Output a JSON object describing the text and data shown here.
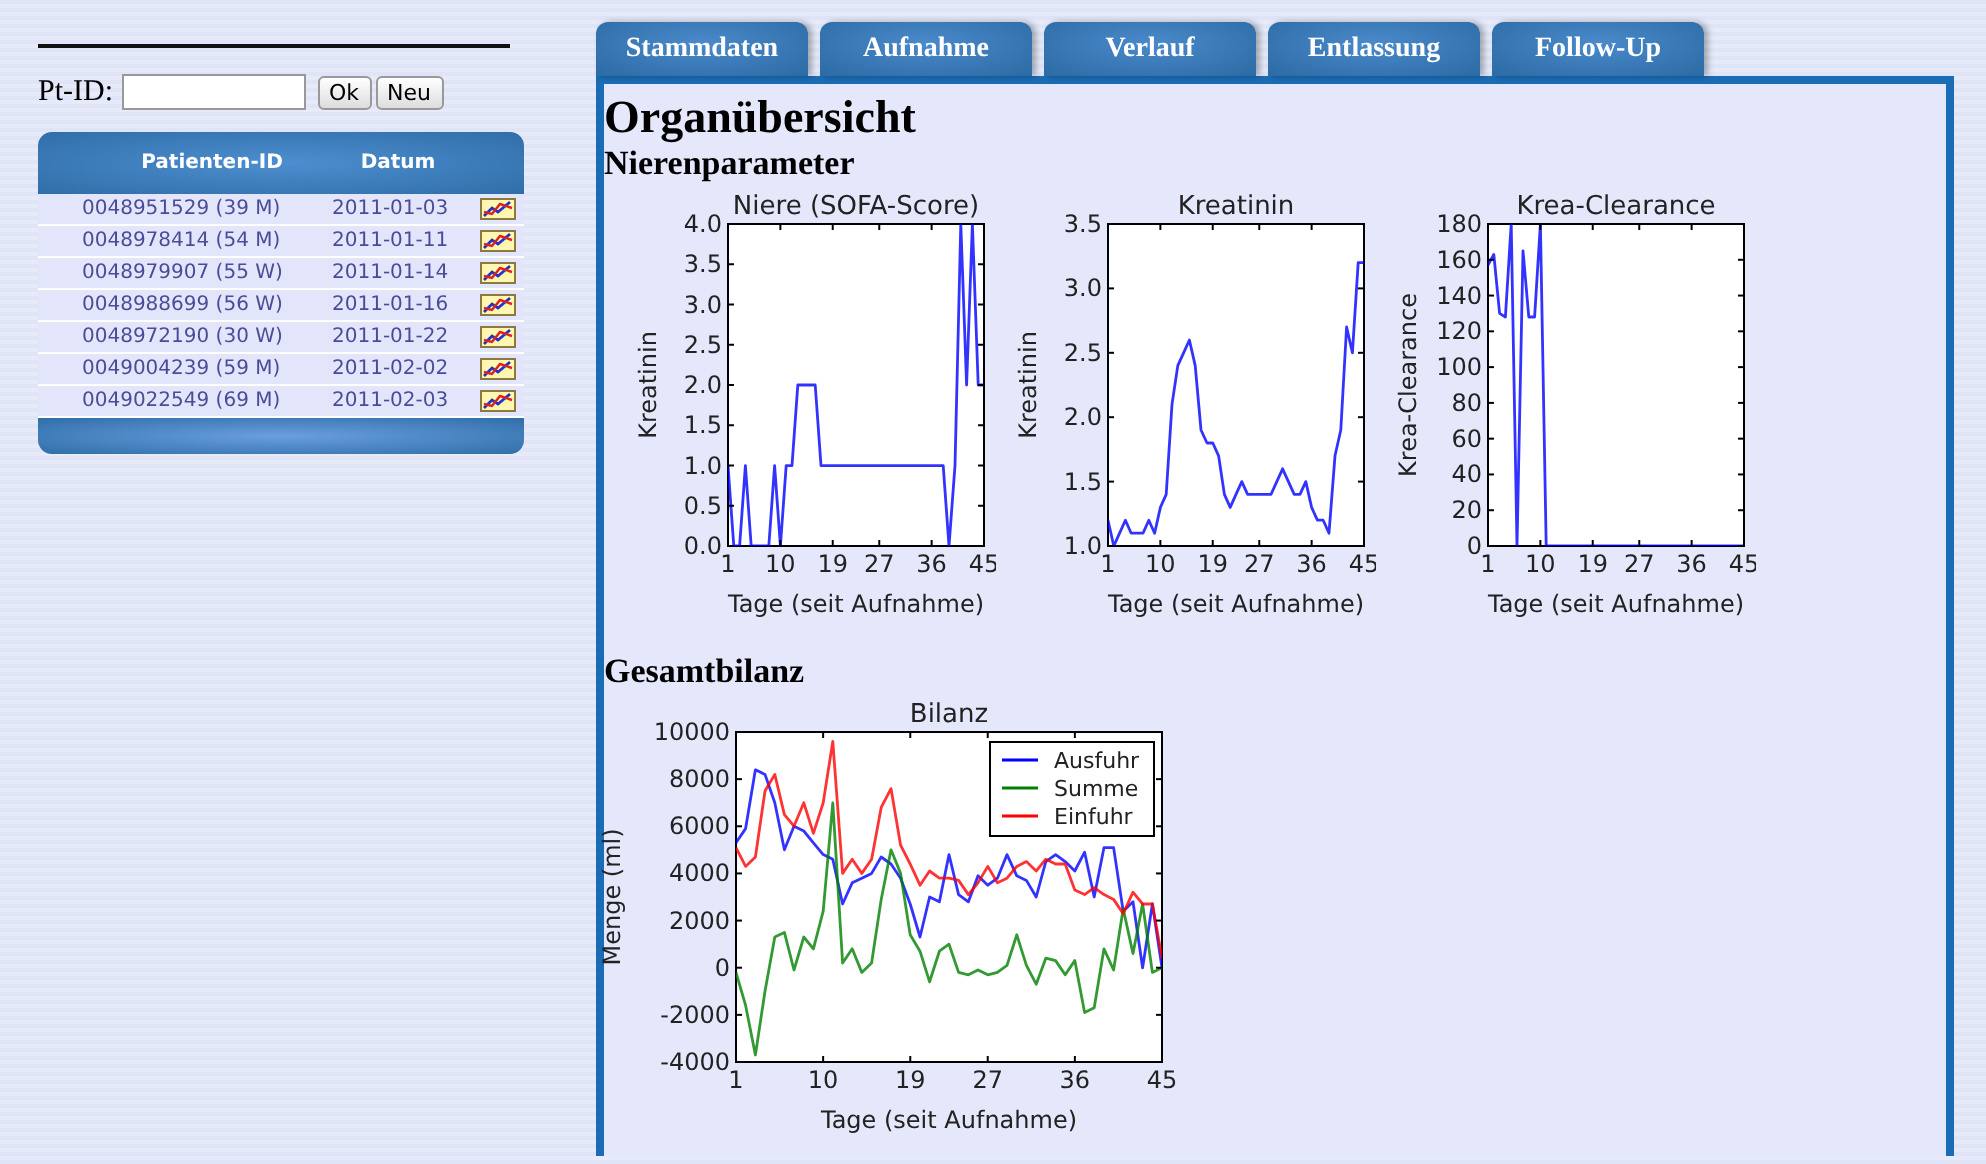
{
  "sidebar": {
    "search": {
      "label": "Pt-ID:",
      "buttons": [
        "Ok",
        "Neu"
      ]
    },
    "table": {
      "columns": [
        "Patienten-ID",
        "Datum"
      ],
      "rows": [
        {
          "patient": "0048951529 (39 M)",
          "date": "2011-01-03"
        },
        {
          "patient": "0048978414 (54 M)",
          "date": "2011-01-11"
        },
        {
          "patient": "0048979907 (55 W)",
          "date": "2011-01-14"
        },
        {
          "patient": "0048988699 (56 W)",
          "date": "2011-01-16"
        },
        {
          "patient": "0048972190 (30 W)",
          "date": "2011-01-22"
        },
        {
          "patient": "0049004239 (59 M)",
          "date": "2011-02-02"
        },
        {
          "patient": "0049022549 (69 M)",
          "date": "2011-02-03"
        }
      ]
    }
  },
  "tabs": [
    {
      "label": "Stammdaten"
    },
    {
      "label": "Aufnahme"
    },
    {
      "label": "Verlauf"
    },
    {
      "label": "Entlassung"
    },
    {
      "label": "Follow-Up"
    }
  ],
  "page": {
    "title": "Organübersicht",
    "sections": [
      {
        "heading": "Nierenparameter",
        "charts": [
          {
            "chart_data": {
              "type": "line",
              "title": "Niere (SOFA-Score)",
              "xlabel": "Tage (seit Aufnahme)",
              "ylabel": "Kreatinin",
              "xlim": [
                1,
                45
              ],
              "ylim": [
                0,
                4
              ],
              "xticks": [
                1,
                10,
                19,
                27,
                36,
                45
              ],
              "yticks": [
                {
                  "value": 0,
                  "label": "0.0"
                },
                {
                  "value": 0.5,
                  "label": "0.5"
                },
                {
                  "value": 1,
                  "label": "1.0"
                },
                {
                  "value": 1.5,
                  "label": "1.5"
                },
                {
                  "value": 2,
                  "label": "2.0"
                },
                {
                  "value": 2.5,
                  "label": "2.5"
                },
                {
                  "value": 3,
                  "label": "3.0"
                },
                {
                  "value": 3.5,
                  "label": "3.5"
                },
                {
                  "value": 4,
                  "label": "4.0"
                }
              ],
              "x": [
                1,
                2,
                3,
                4,
                5,
                6,
                7,
                8,
                9,
                10,
                11,
                12,
                13,
                14,
                15,
                16,
                17,
                18,
                19,
                20,
                21,
                22,
                23,
                24,
                25,
                26,
                27,
                28,
                29,
                30,
                31,
                32,
                33,
                34,
                35,
                36,
                37,
                38,
                39,
                40,
                41,
                42,
                43,
                44,
                45
              ],
              "series": [
                {
                  "color": "#0000ff",
                  "values": [
                    1,
                    0,
                    0,
                    1,
                    0,
                    0,
                    0,
                    0,
                    1,
                    0,
                    1,
                    1,
                    2,
                    2,
                    2,
                    2,
                    1,
                    1,
                    1,
                    1,
                    1,
                    1,
                    1,
                    1,
                    1,
                    1,
                    1,
                    1,
                    1,
                    1,
                    1,
                    1,
                    1,
                    1,
                    1,
                    1,
                    1,
                    1,
                    0,
                    1,
                    4,
                    2,
                    4,
                    2,
                    2
                  ]
                }
              ]
            }
          },
          {
            "chart_data": {
              "type": "line",
              "title": "Kreatinin",
              "xlabel": "Tage (seit Aufnahme)",
              "ylabel": "Kreatinin",
              "xlim": [
                1,
                45
              ],
              "ylim": [
                1,
                3.5
              ],
              "xticks": [
                1,
                10,
                19,
                27,
                36,
                45
              ],
              "yticks": [
                {
                  "value": 1,
                  "label": "1.0"
                },
                {
                  "value": 1.5,
                  "label": "1.5"
                },
                {
                  "value": 2,
                  "label": "2.0"
                },
                {
                  "value": 2.5,
                  "label": "2.5"
                },
                {
                  "value": 3,
                  "label": "3.0"
                },
                {
                  "value": 3.5,
                  "label": "3.5"
                }
              ],
              "x": [
                1,
                2,
                3,
                4,
                5,
                6,
                7,
                8,
                9,
                10,
                11,
                12,
                13,
                14,
                15,
                16,
                17,
                18,
                19,
                20,
                21,
                22,
                23,
                24,
                25,
                26,
                27,
                28,
                29,
                30,
                31,
                32,
                33,
                34,
                35,
                36,
                37,
                38,
                39,
                40,
                41,
                42,
                43,
                44,
                45
              ],
              "series": [
                {
                  "color": "#0000ff",
                  "values": [
                    1.2,
                    1.0,
                    1.1,
                    1.2,
                    1.1,
                    1.1,
                    1.1,
                    1.2,
                    1.1,
                    1.3,
                    1.4,
                    2.1,
                    2.4,
                    2.5,
                    2.6,
                    2.4,
                    1.9,
                    1.8,
                    1.8,
                    1.7,
                    1.4,
                    1.3,
                    1.4,
                    1.5,
                    1.4,
                    1.4,
                    1.4,
                    1.4,
                    1.4,
                    1.5,
                    1.6,
                    1.5,
                    1.4,
                    1.4,
                    1.5,
                    1.3,
                    1.2,
                    1.2,
                    1.1,
                    1.7,
                    1.9,
                    2.7,
                    2.5,
                    3.2,
                    3.2
                  ]
                }
              ]
            }
          },
          {
            "chart_data": {
              "type": "line",
              "title": "Krea-Clearance",
              "xlabel": "Tage (seit Aufnahme)",
              "ylabel": "Krea-Clearance",
              "xlim": [
                1,
                45
              ],
              "ylim": [
                0,
                180
              ],
              "xticks": [
                1,
                10,
                19,
                27,
                36,
                45
              ],
              "yticks": [
                0,
                20,
                40,
                60,
                80,
                100,
                120,
                140,
                160,
                180
              ],
              "x": [
                1,
                2,
                3,
                4,
                5,
                6,
                7,
                8,
                9,
                10,
                11,
                12,
                13,
                14,
                15,
                16,
                17,
                18,
                19,
                20,
                21,
                22,
                23,
                24,
                25,
                26,
                27,
                28,
                29,
                30,
                31,
                32,
                33,
                34,
                35,
                36,
                37,
                38,
                39,
                40,
                41,
                42,
                43,
                44,
                45
              ],
              "series": [
                {
                  "color": "#0000ff",
                  "values": [
                    157,
                    163,
                    130,
                    128,
                    180,
                    0,
                    165,
                    128,
                    128,
                    180,
                    0,
                    0,
                    0,
                    0,
                    0,
                    0,
                    0,
                    0,
                    0,
                    0,
                    0,
                    0,
                    0,
                    0,
                    0,
                    0,
                    0,
                    0,
                    0,
                    0,
                    0,
                    0,
                    0,
                    0,
                    0,
                    0,
                    0,
                    0,
                    0,
                    0,
                    0,
                    0,
                    0,
                    0,
                    0
                  ]
                }
              ]
            }
          }
        ]
      },
      {
        "heading": "Gesamtbilanz",
        "charts": [
          {
            "chart_data": {
              "type": "line",
              "title": "Bilanz",
              "xlabel": "Tage (seit Aufnahme)",
              "ylabel": "Menge (ml)",
              "xlim": [
                1,
                45
              ],
              "ylim": [
                -4000,
                10000
              ],
              "xticks": [
                1,
                10,
                19,
                27,
                36,
                45
              ],
              "yticks": [
                -4000,
                -2000,
                0,
                2000,
                4000,
                6000,
                8000,
                10000
              ],
              "legend": true,
              "x": [
                1,
                2,
                3,
                4,
                5,
                6,
                7,
                8,
                9,
                10,
                11,
                12,
                13,
                14,
                15,
                16,
                17,
                18,
                19,
                20,
                21,
                22,
                23,
                24,
                25,
                26,
                27,
                28,
                29,
                30,
                31,
                32,
                33,
                34,
                35,
                36,
                37,
                38,
                39,
                40,
                41,
                42,
                43,
                44,
                45
              ],
              "series": [
                {
                  "name": "Ausfuhr",
                  "color": "#0000ff",
                  "values": [
                    5300,
                    5900,
                    8400,
                    8200,
                    7000,
                    5000,
                    6000,
                    5800,
                    5300,
                    4800,
                    4600,
                    2700,
                    3600,
                    3800,
                    4000,
                    4700,
                    4400,
                    3800,
                    2700,
                    1300,
                    3000,
                    2800,
                    4800,
                    3100,
                    2800,
                    3900,
                    3500,
                    3800,
                    4800,
                    3900,
                    3700,
                    3000,
                    4500,
                    4800,
                    4500,
                    4100,
                    4900,
                    3000,
                    5100,
                    5100,
                    2400,
                    2800,
                    0,
                    2700,
                    0
                  ]
                },
                {
                  "name": "Summe",
                  "color": "#008000",
                  "values": [
                    -200,
                    -1600,
                    -3700,
                    -1000,
                    1300,
                    1500,
                    -100,
                    1300,
                    800,
                    2400,
                    7000,
                    200,
                    800,
                    -200,
                    200,
                    2900,
                    5000,
                    4000,
                    1400,
                    700,
                    -600,
                    700,
                    1000,
                    -200,
                    -300,
                    -100,
                    -300,
                    -200,
                    100,
                    1400,
                    100,
                    -700,
                    400,
                    300,
                    -300,
                    300,
                    -1900,
                    -1700,
                    800,
                    -100,
                    2500,
                    600,
                    2700,
                    -200,
                    0
                  ]
                },
                {
                  "name": "Einfuhr",
                  "color": "#ff0000",
                  "values": [
                    5100,
                    4300,
                    4700,
                    7500,
                    8200,
                    6500,
                    6000,
                    7000,
                    5700,
                    7000,
                    9600,
                    4000,
                    4600,
                    4000,
                    4600,
                    6800,
                    7600,
                    5200,
                    4400,
                    3500,
                    4100,
                    3800,
                    3800,
                    3700,
                    3100,
                    3600,
                    4300,
                    3600,
                    3800,
                    4300,
                    4500,
                    4100,
                    4600,
                    4400,
                    4400,
                    3300,
                    3100,
                    3400,
                    3100,
                    2900,
                    2300,
                    3200,
                    2700,
                    2700,
                    400
                  ]
                }
              ]
            }
          }
        ]
      }
    ]
  }
}
